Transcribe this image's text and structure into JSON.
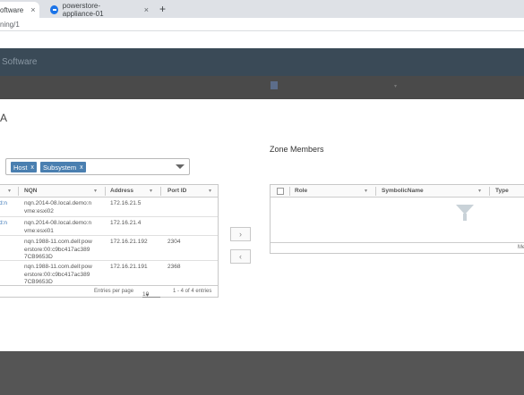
{
  "browser": {
    "tabs": [
      {
        "label": "oftware",
        "active": true
      },
      {
        "label": "powerstore-appliance-01",
        "active": false
      }
    ],
    "new_tab": "+",
    "close_glyph": "×",
    "url": "ning/1"
  },
  "app": {
    "title": "Software"
  },
  "page": {
    "title": "A",
    "zone_members_title": "Zone Members"
  },
  "filter": {
    "pills": [
      {
        "label": "Host",
        "remove": "x"
      },
      {
        "label": "Subsystem",
        "remove": "x"
      }
    ]
  },
  "left_table": {
    "columns": [
      "NQN",
      "Address",
      "Port ID"
    ],
    "rows": [
      {
        "prefix": "d:n",
        "nqn": [
          "nqn.2014-08.local.demo:n",
          "vme:esxi02"
        ],
        "address": "172.16.21.5",
        "port_id": ""
      },
      {
        "prefix": "d:n",
        "nqn": [
          "nqn.2014-08.local.demo:n",
          "vme:esxi01"
        ],
        "address": "172.16.21.4",
        "port_id": ""
      },
      {
        "prefix": "",
        "nqn": [
          "nqn.1988-11.com.dell:pow",
          "erstore:00:c9bc417ac389",
          "7CB9653D"
        ],
        "address": "172.16.21.192",
        "port_id": "2304"
      },
      {
        "prefix": "",
        "nqn": [
          "nqn.1988-11.com.dell:pow",
          "erstore:00:c9bc417ac389",
          "7CB9653D"
        ],
        "address": "172.16.21.191",
        "port_id": "2368"
      }
    ],
    "footer": {
      "entries_per_page_label": "Entries per page",
      "entries_per_page_value": "10",
      "range": "1 - 4 of 4 entries"
    }
  },
  "move_buttons": {
    "add": "›",
    "remove": "‹"
  },
  "right_table": {
    "columns": [
      "Role",
      "SymbolicName",
      "Type"
    ],
    "footer": "Me"
  },
  "icons": {
    "filter": "▾",
    "funnel": "funnel-icon"
  },
  "colors": {
    "header": "#3a4a57",
    "pill": "#4a7fb0",
    "link": "#3b77b8"
  }
}
